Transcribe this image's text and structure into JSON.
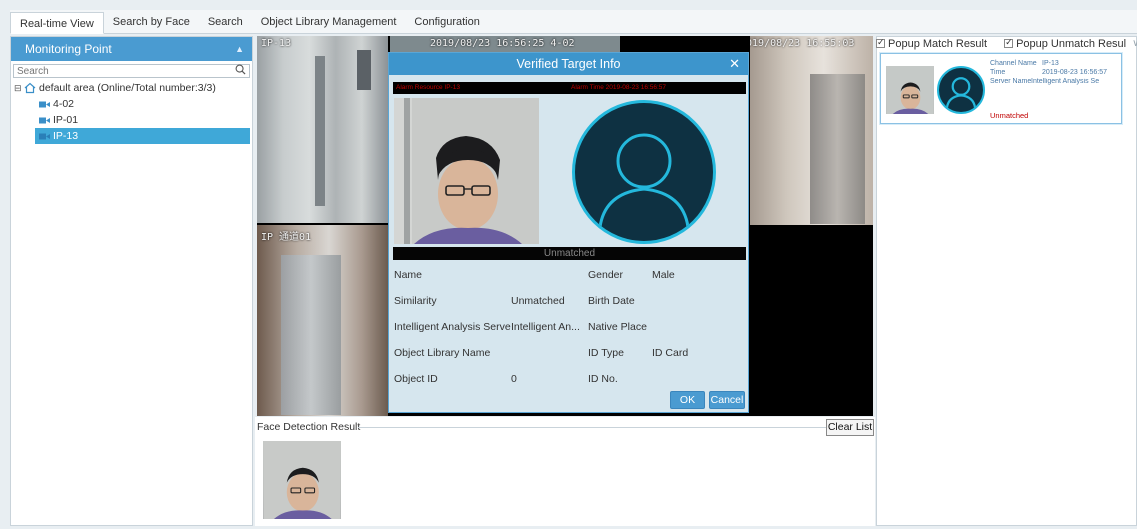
{
  "tabs": [
    "Real-time View",
    "Search by Face",
    "Search",
    "Object Library Management",
    "Configuration"
  ],
  "monitoring": {
    "title": "Monitoring Point",
    "search_placeholder": "Search",
    "root_label": "default area (Online/Total number:3/3)",
    "cameras": [
      "4-02",
      "IP-01",
      "IP-13"
    ],
    "selected": "IP-13"
  },
  "video": {
    "cam1_osd": "IP-13",
    "cam2_osd": "IP 通道01",
    "cam3_osd": "2019/08/23 16:56:25 4-02",
    "cam4_osd": "2019/08/23 16:55:03"
  },
  "dialog": {
    "title": "Verified Target Info",
    "alarm_resource": "Alarm Resource IP-13",
    "alarm_time": "Alarm Time     2019-08-23 16:56:57",
    "status": "Unmatched",
    "fields": {
      "name_label": "Name",
      "name_value": "",
      "similarity_label": "Similarity",
      "similarity_value": "Unmatched",
      "server_label": "Intelligent Analysis Serve",
      "server_value": "Intelligent An...",
      "library_label": "Object Library Name",
      "library_value": "",
      "object_id_label": "Object ID",
      "object_id_value": "0",
      "gender_label": "Gender",
      "gender_value": "Male",
      "birth_label": "Birth Date",
      "birth_value": "",
      "native_label": "Native Place",
      "native_value": "",
      "idtype_label": "ID Type",
      "idtype_value": "ID Card",
      "idno_label": "ID No.",
      "idno_value": ""
    },
    "ok_label": "OK",
    "cancel_label": "Cancel"
  },
  "face_detection": {
    "label": "Face Detection Result",
    "clear_label": "Clear List"
  },
  "right": {
    "popup_match": "Popup Match Result",
    "popup_unmatch": "Popup Unmatch Resul",
    "card": {
      "channel_label": "Channel Name",
      "channel_value": "IP-13",
      "time_label": "Time",
      "time_value": "2019-08-23 16:56:57",
      "server_label": "Server Name",
      "server_value": "Intelligent Analysis Se",
      "status": "Unmatched"
    }
  },
  "colors": {
    "accent": "#4a9bd1",
    "selected": "#3fa8d8",
    "alarm_red": "#c00000",
    "avatar_ring": "#24b8dc"
  }
}
